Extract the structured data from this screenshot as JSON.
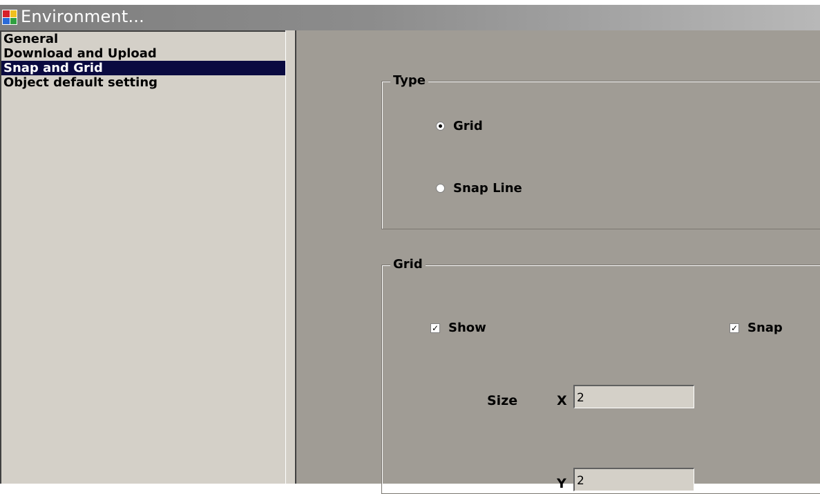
{
  "window": {
    "title": "Environment..."
  },
  "sidebar": {
    "items": [
      {
        "label": "General"
      },
      {
        "label": "Download and Upload"
      },
      {
        "label": "Snap and Grid"
      },
      {
        "label": "Object default setting"
      }
    ],
    "selected_index": 2
  },
  "type_group": {
    "legend": "Type",
    "options": [
      {
        "label": "Grid",
        "checked": true
      },
      {
        "label": "Snap Line",
        "checked": false
      }
    ]
  },
  "grid_group": {
    "legend": "Grid",
    "show": {
      "label": "Show",
      "checked": true
    },
    "snap": {
      "label": "Snap",
      "checked": true
    },
    "size_label": "Size",
    "x_label": "X",
    "x_value": "2",
    "y_label": "Y",
    "y_value": "2"
  },
  "colors": {
    "panel": "#a09c95",
    "list_bg": "#d4d0c8",
    "selection": "#0a0a40",
    "titlebar_text": "#ffffff"
  },
  "icons": {
    "app": "app-window-icon"
  }
}
